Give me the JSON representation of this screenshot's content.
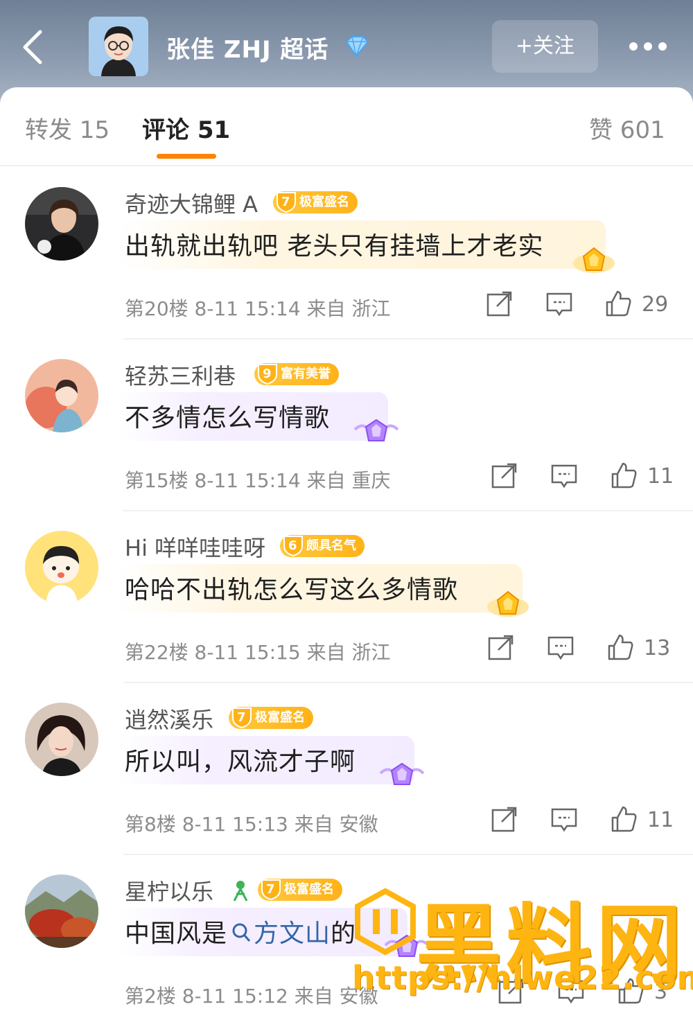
{
  "header": {
    "title": "张佳 ZHJ 超话",
    "follow_label": "+关注"
  },
  "tabs": {
    "repost": "转发 15",
    "comments": "评论 51",
    "likes": "赞 601"
  },
  "colors": {
    "accent": "#ff8200",
    "badge": "#ffb218",
    "link": "#3366aa"
  },
  "comments": [
    {
      "user": "奇迹大锦鲤 A",
      "level": "7",
      "badge": "极富盛名",
      "text": "出轨就出轨吧 老头只有挂墙上才老实",
      "meta": "第20楼 8-11 15:14 来自 浙江",
      "likes": "29",
      "gem": "gold"
    },
    {
      "user": "轻苏三利巷",
      "level": "9",
      "badge": "富有美誉",
      "text": "不多情怎么写情歌",
      "meta": "第15楼 8-11 15:14 来自 重庆",
      "likes": "11",
      "gem": "purple"
    },
    {
      "user": "Hi 咩咩哇哇呀",
      "level": "6",
      "badge": "颇具名气",
      "text": "哈哈不出轨怎么写这么多情歌",
      "meta": "第22楼 8-11 15:15 来自 浙江",
      "likes": "13",
      "gem": "gold"
    },
    {
      "user": "逍然溪乐",
      "level": "7",
      "badge": "极富盛名",
      "text": "所以叫，风流才子啊",
      "meta": "第8楼 8-11 15:13 来自 安徽",
      "likes": "11",
      "gem": "purple"
    },
    {
      "user": "星柠以乐",
      "level": "7",
      "badge": "极富盛名",
      "text_prefix": "中国风是",
      "topic": "方文山",
      "text_suffix": "的",
      "meta": "第2楼 8-11 15:12 来自 安徽",
      "likes": "3",
      "gem": "purple"
    }
  ],
  "watermark": {
    "text": "黑料网",
    "url": "https://hlwe22.com"
  }
}
